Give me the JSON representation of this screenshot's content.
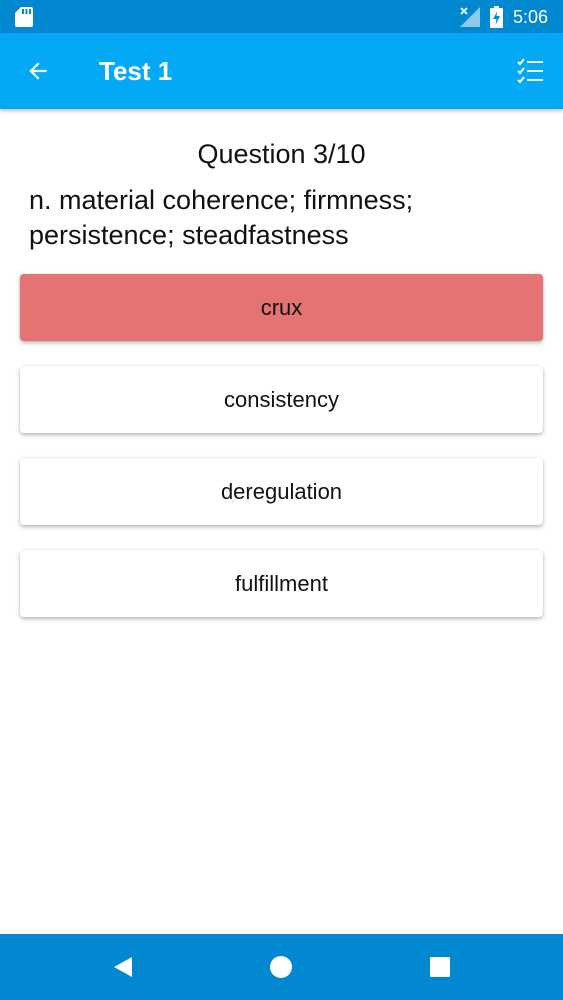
{
  "status_bar": {
    "time": "5:06",
    "icons": [
      "sd-card-icon",
      "signal-off-icon",
      "battery-charging-icon"
    ]
  },
  "app_bar": {
    "title": "Test 1",
    "back_icon": "arrow-back-icon",
    "action_icon": "checklist-icon"
  },
  "quiz": {
    "question_number": "Question 3/10",
    "definition": "n. material coherence; firmness; persistence; steadfastness",
    "answers": [
      {
        "label": "crux",
        "state": "wrong"
      },
      {
        "label": "consistency",
        "state": "default"
      },
      {
        "label": "deregulation",
        "state": "default"
      },
      {
        "label": "fulfillment",
        "state": "default"
      }
    ]
  },
  "nav_bar": {
    "icons": [
      "nav-back-icon",
      "nav-home-icon",
      "nav-recents-icon"
    ]
  },
  "colors": {
    "status_bar": "#0288d1",
    "app_bar": "#03a9f4",
    "wrong_answer": "#e57373",
    "nav_bar": "#0288d1"
  }
}
